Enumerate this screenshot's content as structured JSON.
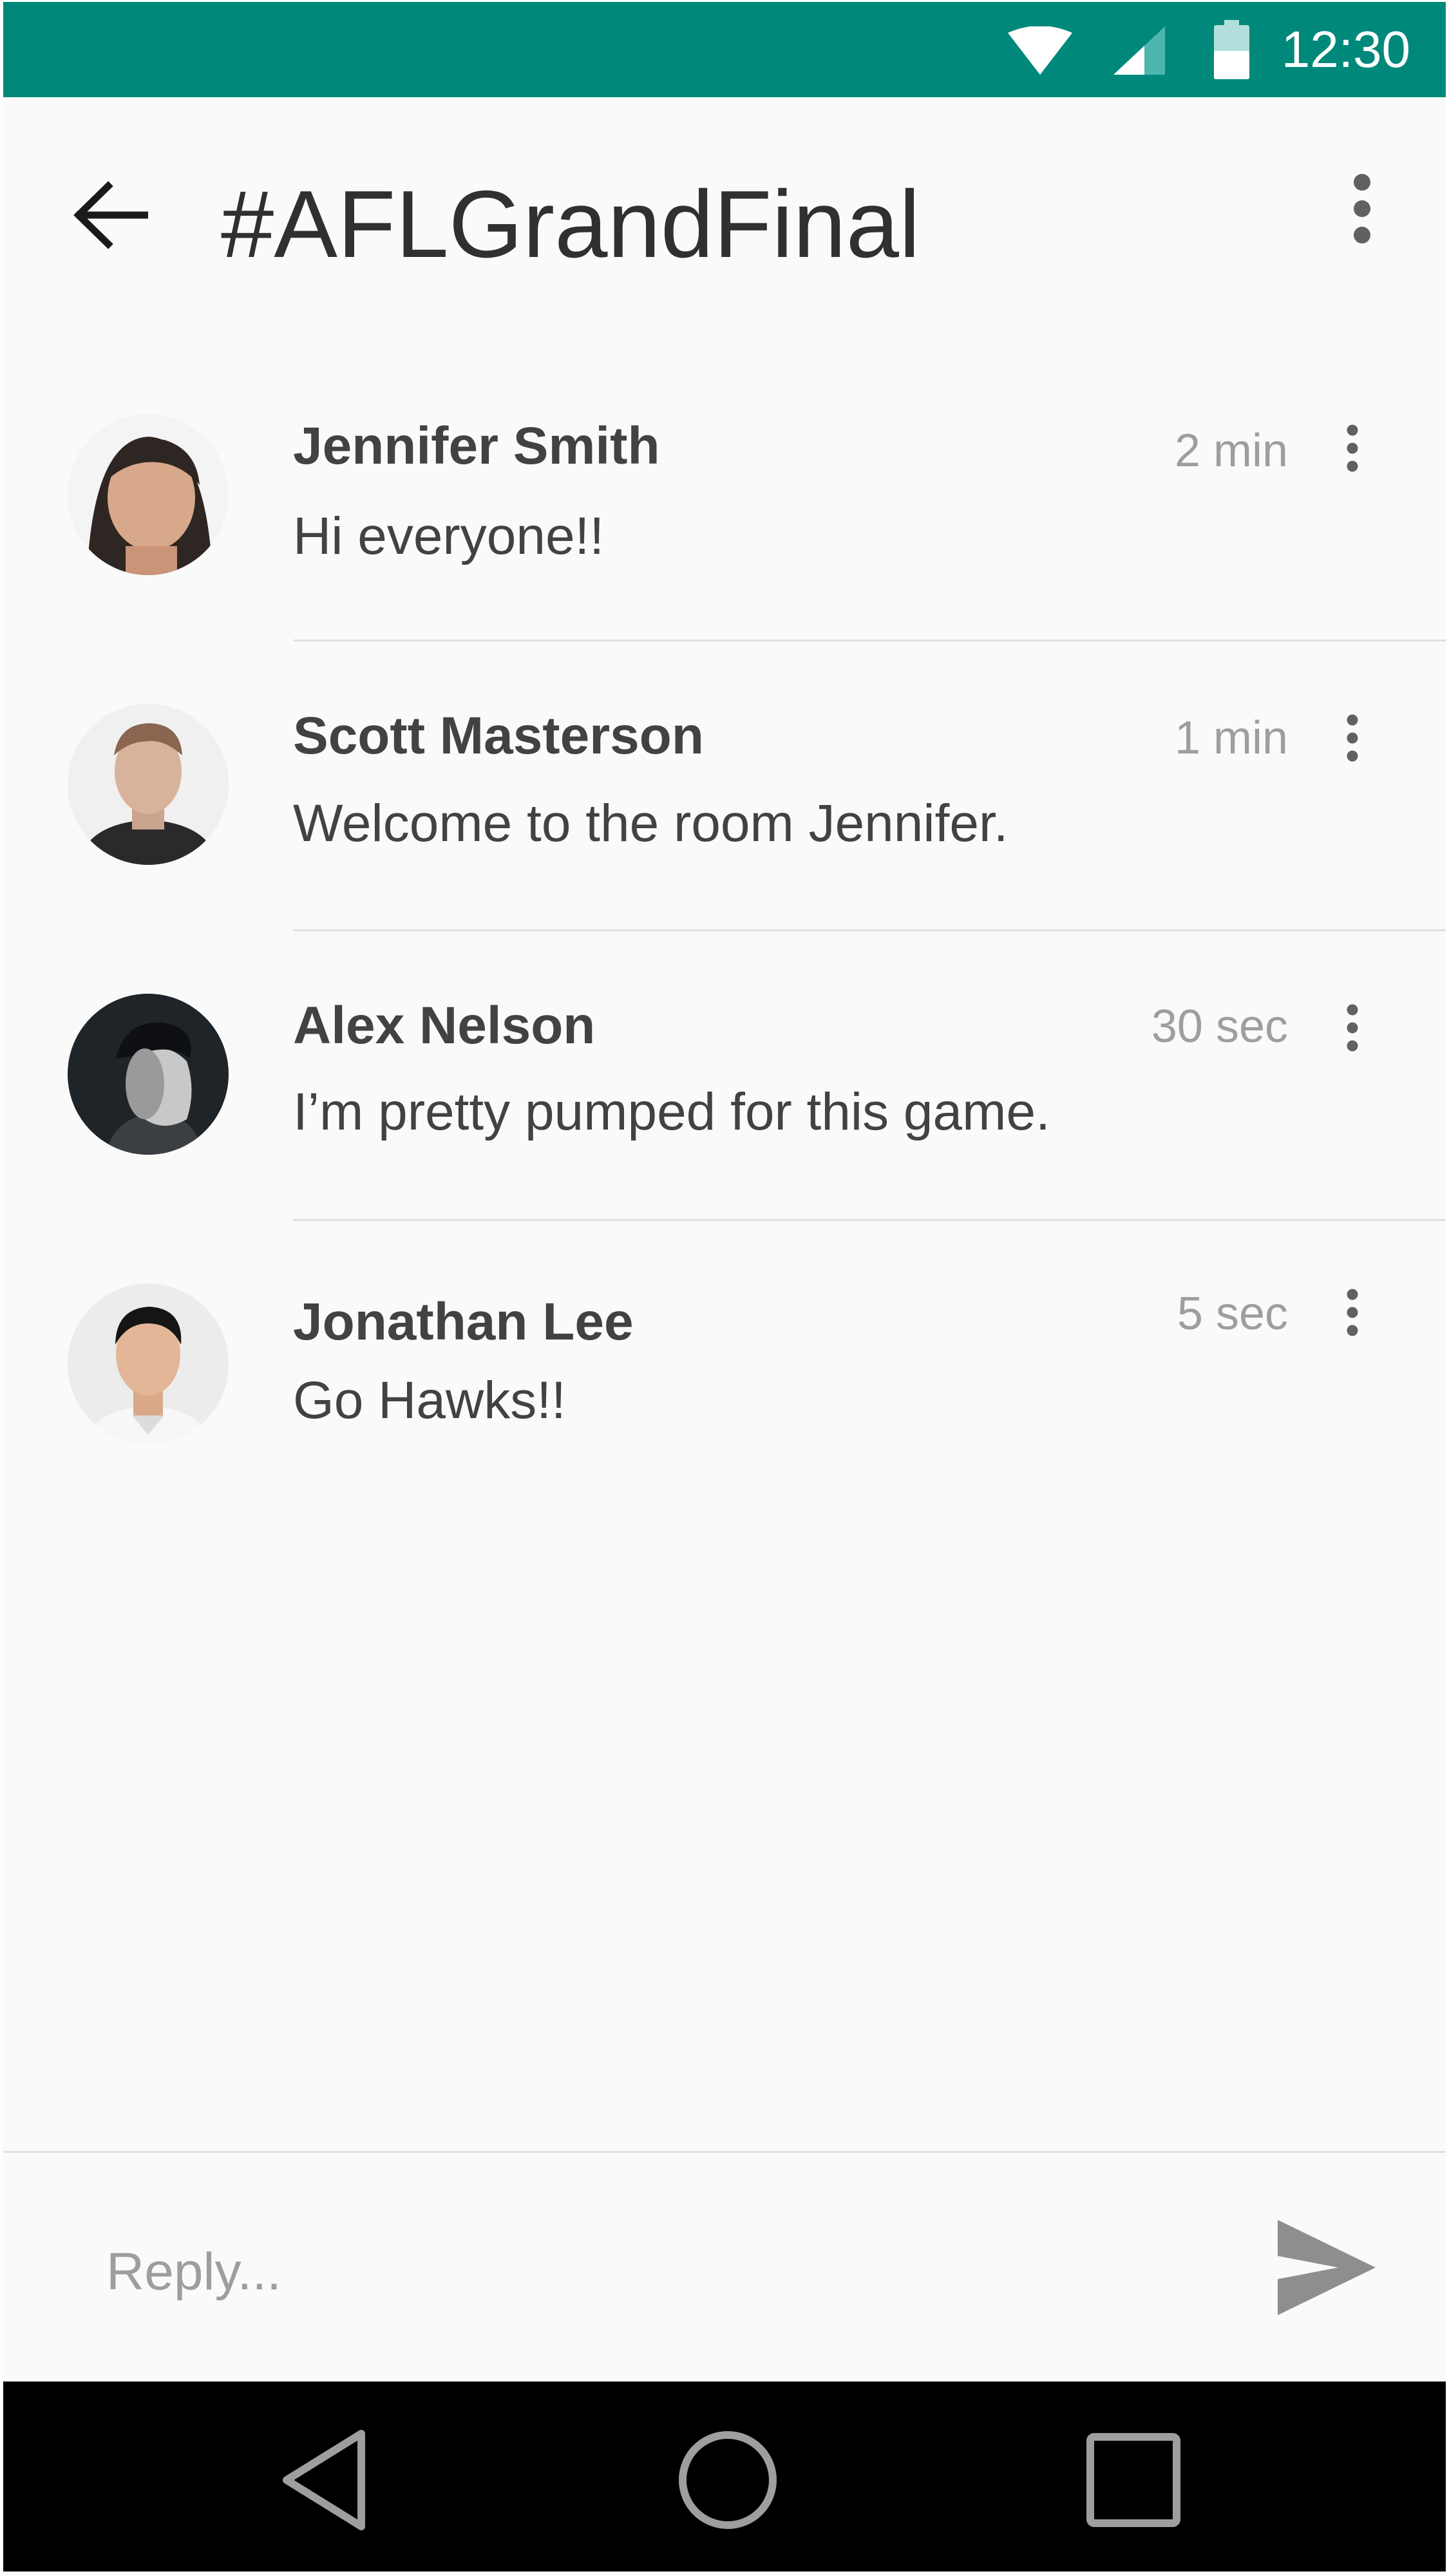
{
  "status_bar": {
    "time": "12:30",
    "icons": [
      "wifi-icon",
      "cellular-signal-icon",
      "battery-icon"
    ],
    "background": "#00897b"
  },
  "app_bar": {
    "back_icon": "arrow-back-icon",
    "title": "#AFLGrandFinal",
    "overflow_icon": "more-vert-icon"
  },
  "messages": [
    {
      "sender": "Jennifer Smith",
      "text": "Hi everyone!!",
      "time": "2 min",
      "avatar": "avatar-jennifer-smith"
    },
    {
      "sender": "Scott Masterson",
      "text": "Welcome to the room Jennifer.",
      "time": "1 min",
      "avatar": "avatar-scott-masterson"
    },
    {
      "sender": "Alex Nelson",
      "text": "I’m pretty pumped for this game.",
      "time": "30 sec",
      "avatar": "avatar-alex-nelson"
    },
    {
      "sender": "Jonathan Lee",
      "text": "Go Hawks!!",
      "time": "5 sec",
      "avatar": "avatar-jonathan-lee"
    }
  ],
  "reply": {
    "placeholder": "Reply...",
    "value": "",
    "send_icon": "send-icon"
  },
  "nav_bar": {
    "icons": [
      "back-triangle-icon",
      "home-circle-icon",
      "recents-square-icon"
    ]
  },
  "colors": {
    "accent": "#00897b",
    "text_primary": "#424242",
    "text_secondary": "#9e9e9e",
    "background": "#fafafa",
    "divider": "#e0e0e0"
  }
}
